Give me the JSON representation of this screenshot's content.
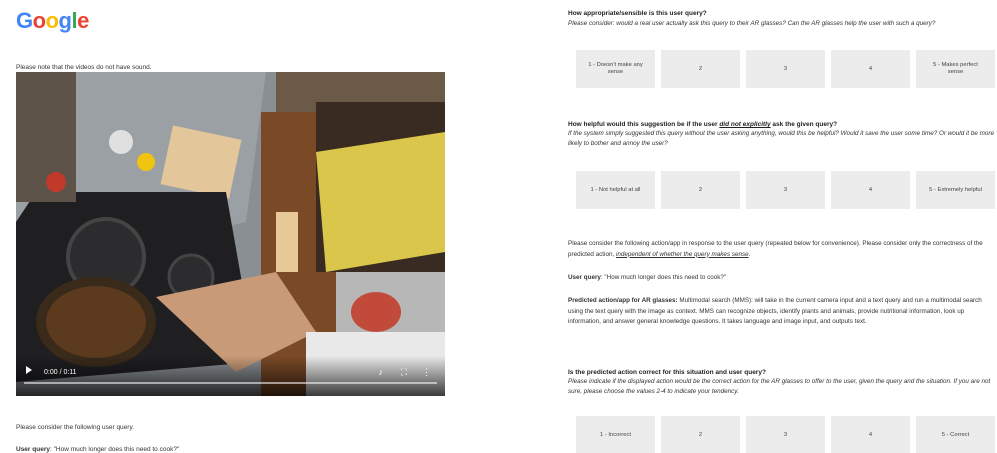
{
  "logo": {
    "letters": [
      "G",
      "o",
      "o",
      "g",
      "l",
      "e"
    ],
    "colors": [
      "#4285F4",
      "#EA4335",
      "#FBBC05",
      "#4285F4",
      "#34A853",
      "#EA4335"
    ]
  },
  "left": {
    "note": "Please note that the videos do not have sound.",
    "video": {
      "time": "0:00 / 0:11",
      "progress_fraction": 0
    },
    "consider": "Please consider the following user query.",
    "user_query_label": "User query",
    "user_query_value": ": \"How much longer does this need to cook?\""
  },
  "right": {
    "q1": {
      "title": "How appropriate/sensible is this user query?",
      "subtitle": "Please consider: would a real user actually ask this query to their AR glasses? Can the AR glasses help the user with such a query?",
      "options": [
        "1 - Doesn't make any sense",
        "2",
        "3",
        "4",
        "5 - Makes perfect sense"
      ]
    },
    "q2": {
      "title_pre": "How helpful would this suggestion be if the user ",
      "title_em": "did not explicitly",
      "title_post": " ask the given query?",
      "subtitle": "If the system simply suggested this query without the user asking anything, would this be helpful? Would it save the user some time? Or would it be more likely to bother and annoy the user?",
      "options": [
        "1 - Not helpful at all",
        "2",
        "3",
        "4",
        "5 - Extremely helpful"
      ]
    },
    "intro_pre": "Please consider the following action/app in response to the user query (repeated below for convenience). Please consider only the correctness of the predicted action, ",
    "intro_em": "independent of whether the query makes sense",
    "intro_post": ".",
    "user_query_label": "User query",
    "user_query_value": ": \"How much longer does this need to cook?\"",
    "predicted_label": "Predicted action/app for AR glasses:",
    "predicted_text": " Multimodal search (MMS): will take in the current camera input and a text query and run a multimodal search using the text query with the image as context. MMS can recognize objects, identify plants and animals, provide nutritional information, look up information, and answer general knowledge questions. It takes language and image input, and outputs text.",
    "q3": {
      "title": "Is the predicted action correct for this situation and user query?",
      "subtitle": "Please indicate if the displayed action would be the correct action for the AR glasses to offer to the user, given the query and the situation. If you are not sure, please choose the values 2-4 to indicate your tendency.",
      "options": [
        "1 - Incorrect",
        "2",
        "3",
        "4",
        "5 - Correct"
      ]
    }
  }
}
